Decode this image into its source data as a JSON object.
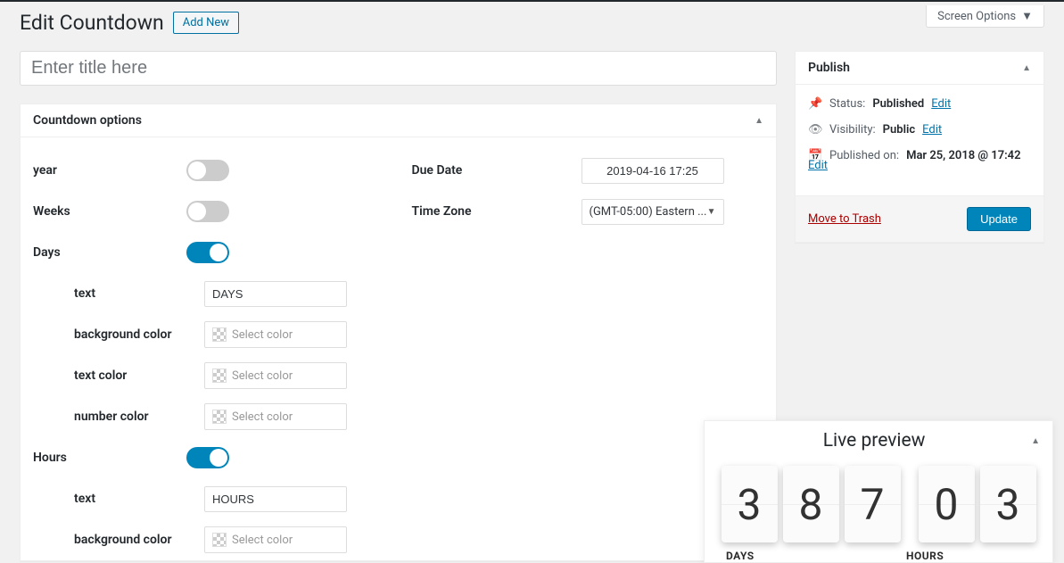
{
  "screen_options_label": "Screen Options",
  "page": {
    "title": "Edit Countdown",
    "add_new_label": "Add New",
    "title_placeholder": "Enter title here"
  },
  "options_box": {
    "heading": "Countdown options",
    "left": {
      "year": {
        "label": "year",
        "value": false
      },
      "weeks": {
        "label": "Weeks",
        "value": false
      },
      "days": {
        "label": "Days",
        "value": true,
        "text_label": "text",
        "text_value": "DAYS",
        "bg_label": "background color",
        "txtcolor_label": "text color",
        "numcolor_label": "number color",
        "color_placeholder": "Select color"
      },
      "hours": {
        "label": "Hours",
        "value": true,
        "text_label": "text",
        "text_value": "HOURS",
        "bg_label": "background color",
        "color_placeholder": "Select color"
      }
    },
    "right": {
      "due_date_label": "Due Date",
      "due_date_value": "2019-04-16 17:25",
      "timezone_label": "Time Zone",
      "timezone_value": "(GMT-05:00) Eastern ..."
    }
  },
  "publish": {
    "heading": "Publish",
    "status_label": "Status:",
    "status_value": "Published",
    "visibility_label": "Visibility:",
    "visibility_value": "Public",
    "published_label": "Published on:",
    "published_value": "Mar 25, 2018 @ 17:42",
    "edit_label": "Edit",
    "trash_label": "Move to Trash",
    "update_label": "Update"
  },
  "preview": {
    "heading": "Live preview",
    "digits": [
      "3",
      "8",
      "7",
      "0",
      "3"
    ],
    "days_label": "DAYS",
    "hours_label": "HOURS"
  }
}
